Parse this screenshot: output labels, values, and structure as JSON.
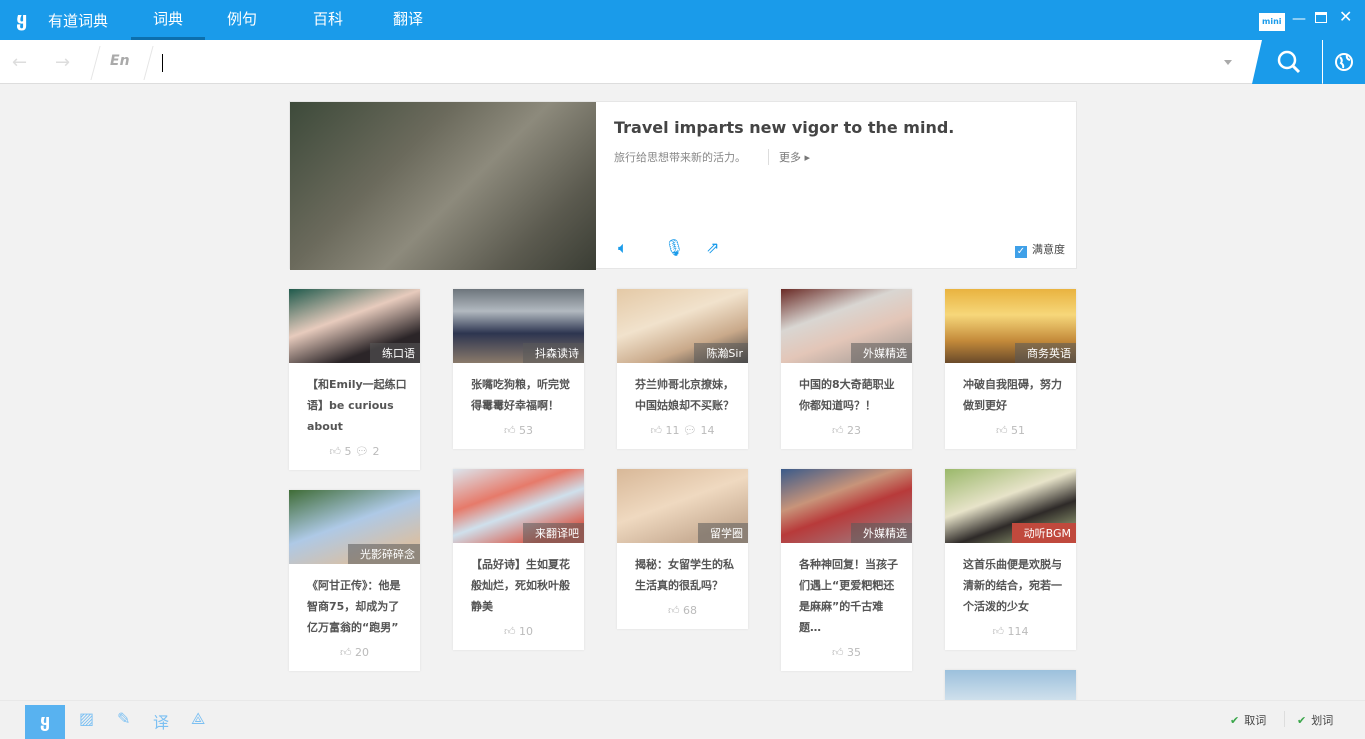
{
  "titlebar": {
    "logo": "logo",
    "app_name": "有道词典",
    "tabs": [
      "词典",
      "例句",
      "百科",
      "翻译"
    ],
    "mini": "mini"
  },
  "search": {
    "lang": "En",
    "value": ""
  },
  "hero": {
    "title": "Travel imparts new vigor to the mind.",
    "subtitle": "旅行给思想带来新的活力。",
    "more": "更多 ▸",
    "satisfaction": "满意度"
  },
  "columns": [
    [
      {
        "tag": "练口语",
        "text": "【和Emily一起练口语】be curious about",
        "likes": "5",
        "comments": "2",
        "img": "linear-gradient(160deg,#1f5a4c 0%,#e7cbbd 40%,#2b2528 75%)"
      },
      {
        "tag": "光影碎碎念",
        "text": "《阿甘正传》：他是智商75，却成为了亿万富翁的“跑男”",
        "likes": "20",
        "img": "linear-gradient(160deg,#3f6c36 0%,#aec9e6 45%,#d6c0a8 80%)"
      }
    ],
    [
      {
        "tag": "抖森读诗",
        "text": "张嘴吃狗粮，听完觉得霉霉好幸福啊！",
        "likes": "53",
        "img": "linear-gradient(180deg,#6d757c 0%,#b2b9c0 30%,#2d3550 60%,#8a7a6a 100%)"
      },
      {
        "tag": "来翻译吧",
        "text": "【品好诗】生如夏花般灿烂，死如秋叶般静美",
        "likes": "10",
        "img": "linear-gradient(160deg,#dce6ee 0%,#e67a6a 35%,#cfe0ec 55%,#d85a4a 85%)"
      }
    ],
    [
      {
        "tag": "陈瀚Sir",
        "text": "芬兰帅哥北京撩妹，中国姑娘却不买账？",
        "likes": "11",
        "comments": "14",
        "img": "linear-gradient(160deg,#e4c9a6 0%,#f1e2cc 40%,#c9a98a 70%,#3a3a3a 100%)"
      },
      {
        "tag": "留学圈",
        "text": "揭秘：女留学生的私生活真的很乱吗？",
        "likes": "68",
        "img": "linear-gradient(160deg,#d8b898 0%,#efd9c0 45%,#cbb097 80%)"
      }
    ],
    [
      {
        "tag": "外媒精选",
        "text": "中国的8大奇葩职业你都知道吗？！",
        "likes": "23",
        "img": "linear-gradient(160deg,#6a2a25 0%,#d9d6d2 35%,#e3c6b8 60%,#9a9591 100%)"
      },
      {
        "tag": "外媒精选",
        "text": "各种神回复！当孩子们遇上“更爱粑粑还是麻麻”的千古难题…",
        "likes": "35",
        "img": "linear-gradient(160deg,#3a5a8a 0%,#c8947a 35%,#b83a3a 55%,#9a8a90 100%)"
      }
    ],
    [
      {
        "tag": "商务英语",
        "text": "冲破自我阻碍，努力做到更好",
        "likes": "51",
        "img": "linear-gradient(180deg,#e9b340 0%,#f6d77a 35%,#c48a3a 70%,#6a4a2a 100%)"
      },
      {
        "tag": "动听BGM",
        "text": "这首乐曲便是欢脱与清新的结合，宛若一个活泼的少女",
        "likes": "114",
        "img": "linear-gradient(160deg,#9ab86a 0%,#e7e3c9 40%,#2e2a28 65%,#b9c890 100%)",
        "tag_color": "#c0493d"
      }
    ]
  ],
  "bottom": {
    "options": [
      "取词",
      "划词"
    ]
  },
  "colors": {
    "brand": "#1a9bea"
  }
}
